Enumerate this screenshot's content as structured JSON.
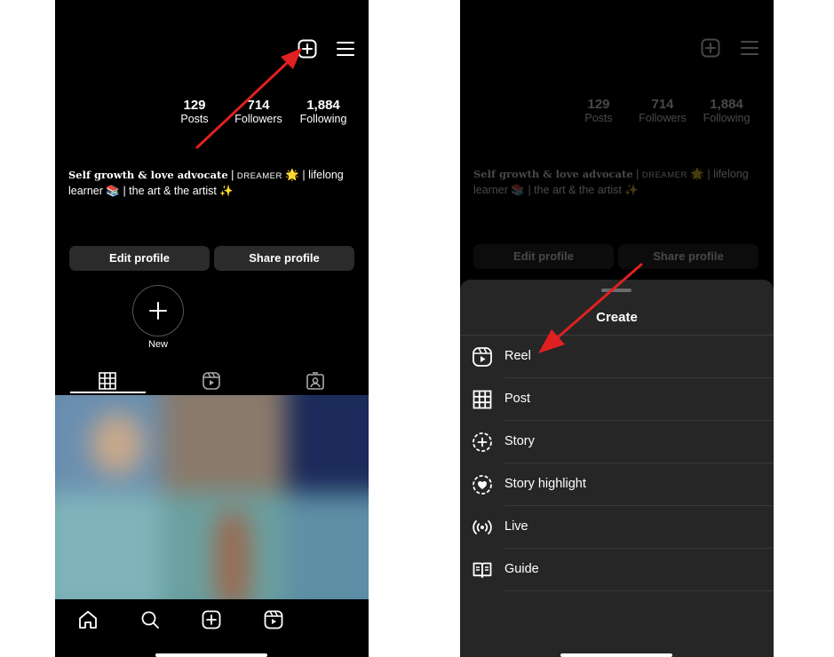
{
  "profile": {
    "stats": [
      {
        "value": "129",
        "label": "Posts"
      },
      {
        "value": "714",
        "label": "Followers"
      },
      {
        "value": "1,884",
        "label": "Following"
      }
    ],
    "bio": {
      "line1_serif": "Self growth & love advocate",
      "line1_sep": " | ",
      "line1_caps": "DREAMER",
      "line1_emoji": " 🌟 ",
      "line1_rest": "| lifelong",
      "line2_start": "learner",
      "line2_emoji": " 📚 ",
      "line2_mid": "| the art & the artist",
      "line2_end": " ✨"
    },
    "edit_button": "Edit profile",
    "share_button": "Share profile",
    "new_highlight_label": "New"
  },
  "create_menu": {
    "title": "Create",
    "items": [
      {
        "label": "Reel",
        "icon": "reel-icon"
      },
      {
        "label": "Post",
        "icon": "grid-icon"
      },
      {
        "label": "Story",
        "icon": "story-add-icon"
      },
      {
        "label": "Story highlight",
        "icon": "highlight-icon"
      },
      {
        "label": "Live",
        "icon": "live-icon"
      },
      {
        "label": "Guide",
        "icon": "guide-icon"
      }
    ]
  },
  "colors": {
    "background": "#000000",
    "sheet": "#262626",
    "button": "#2b2b2b",
    "arrow": "#e02020"
  }
}
